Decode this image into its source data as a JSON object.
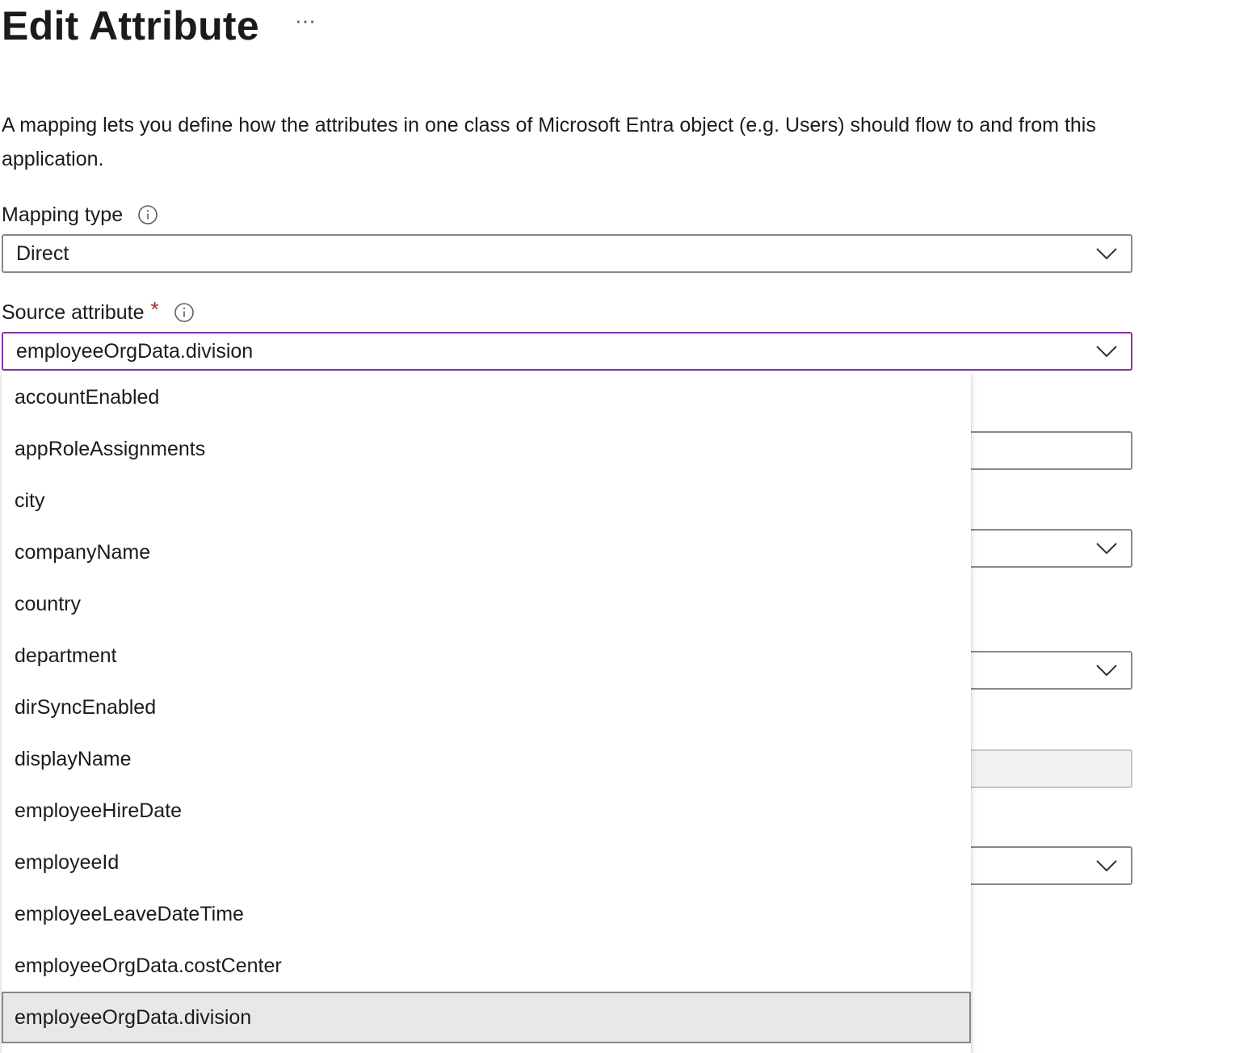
{
  "header": {
    "title": "Edit Attribute",
    "more_label": "···"
  },
  "description": "A mapping lets you define how the attributes in one class of Microsoft Entra object (e.g. Users) should flow to and from this application.",
  "mapping_type": {
    "label": "Mapping type",
    "value": "Direct"
  },
  "source_attribute": {
    "label": "Source attribute",
    "required_marker": "*",
    "value": "employeeOrgData.division",
    "options": [
      "accountEnabled",
      "appRoleAssignments",
      "city",
      "companyName",
      "country",
      "department",
      "dirSyncEnabled",
      "displayName",
      "employeeHireDate",
      "employeeId",
      "employeeLeaveDateTime",
      "employeeOrgData.costCenter",
      "employeeOrgData.division"
    ],
    "selected_option": "employeeOrgData.division"
  },
  "colors": {
    "focus_border": "#8a2fa3",
    "required": "#a4262c",
    "selected_bg": "#e8e8e8"
  }
}
